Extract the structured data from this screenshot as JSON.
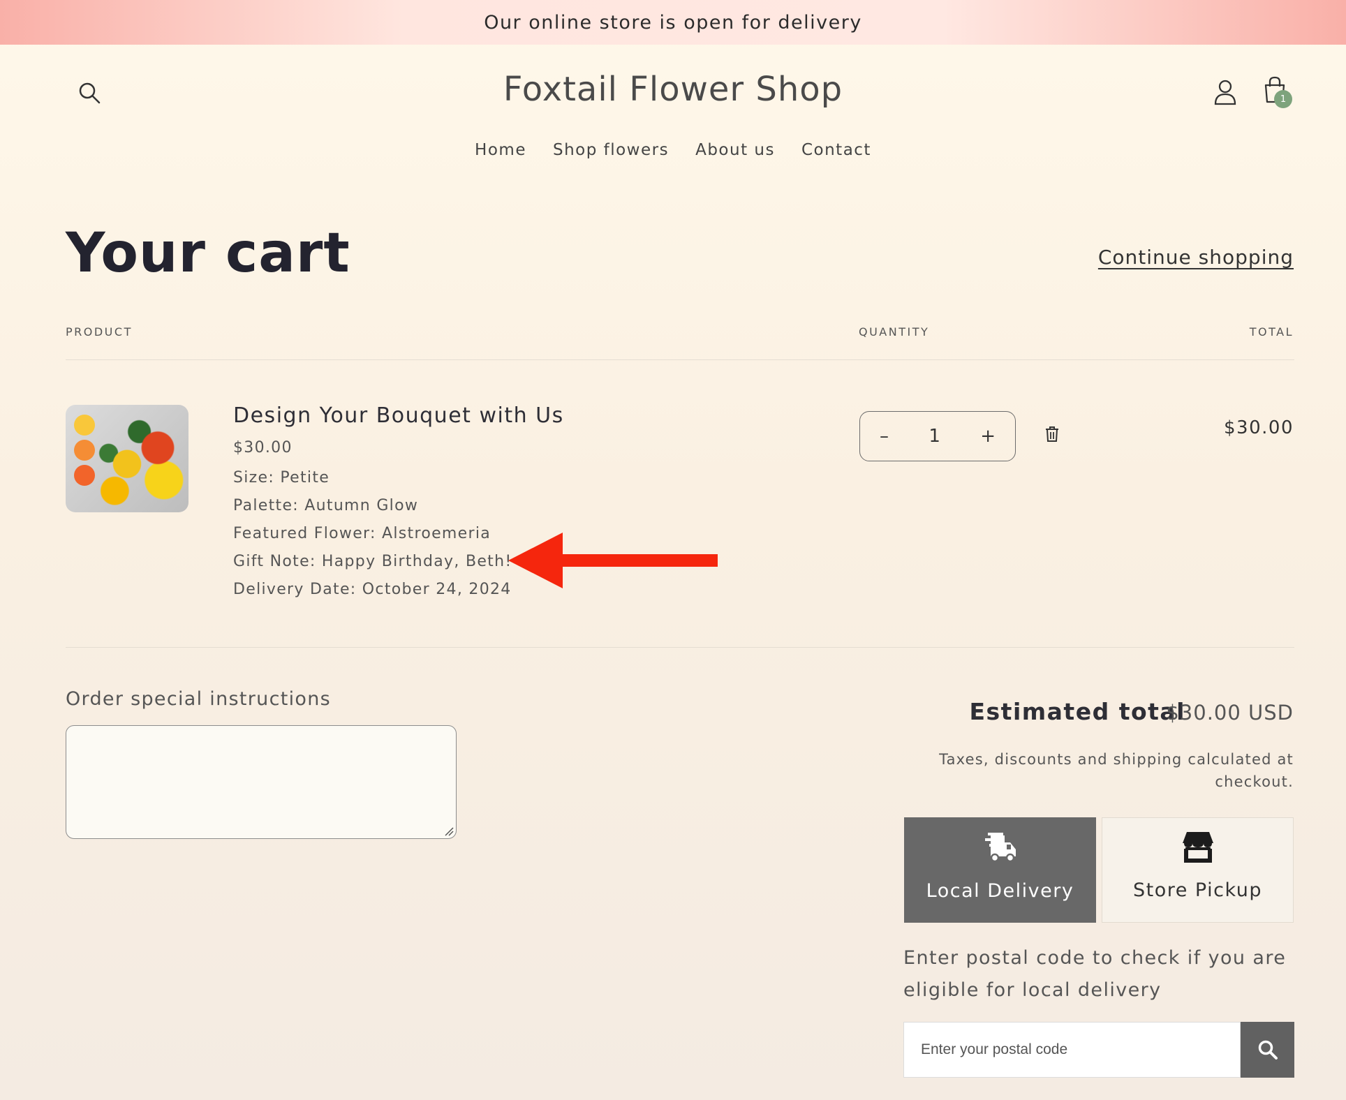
{
  "announcement": "Our online store is open for delivery",
  "header": {
    "title": "Foxtail Flower Shop",
    "cart_count": "1"
  },
  "nav": [
    {
      "label": "Home"
    },
    {
      "label": "Shop flowers"
    },
    {
      "label": "About us"
    },
    {
      "label": "Contact"
    }
  ],
  "cart": {
    "title": "Your cart",
    "continue_label": "Continue shopping",
    "columns": {
      "product": "PRODUCT",
      "quantity": "QUANTITY",
      "total": "TOTAL"
    },
    "item": {
      "name": "Design Your Bouquet with Us",
      "price": "$30.00",
      "options": [
        "Size: Petite",
        "Palette: Autumn Glow",
        "Featured Flower: Alstroemeria",
        "Gift Note: Happy Birthday, Beth!",
        "Delivery Date: October 24, 2024"
      ],
      "quantity": "1",
      "total": "$30.00",
      "palette_colors": [
        "#f9c73a",
        "#f58d35",
        "#f2642a"
      ]
    }
  },
  "instructions": {
    "label": "Order special instructions",
    "value": ""
  },
  "summary": {
    "estimated_label": "Estimated total",
    "estimated_value": "$30.00 USD",
    "note": "Taxes, discounts and shipping calculated at checkout."
  },
  "delivery": {
    "tabs": [
      {
        "label": "Local Delivery",
        "icon": "truck-icon",
        "active": true
      },
      {
        "label": "Store Pickup",
        "icon": "store-icon",
        "active": false
      }
    ],
    "postal_prompt": "Enter postal code to check if you are eligible for local delivery",
    "postal_placeholder": "Enter your postal code"
  },
  "colors": {
    "annotation_arrow": "#f5260d",
    "badge": "#7ea37c",
    "active_tab": "#686868"
  }
}
